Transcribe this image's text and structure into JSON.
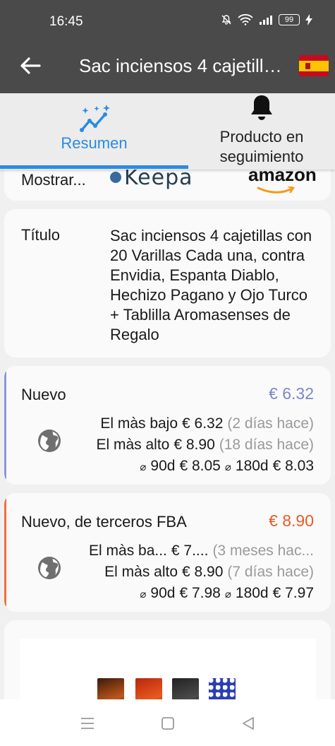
{
  "status_bar": {
    "time": "16:45",
    "battery": "99",
    "icons": [
      "mute-icon",
      "wifi-icon",
      "signal-icon",
      "battery-icon",
      "charging-icon"
    ]
  },
  "app_bar": {
    "title": "Sac inciensos 4 cajetillas con 20 Varillas Cada una, contra Envidia, Espanta Diablo, Hechizo Pagano y Ojo Turco + Tablilla Aromasenses de Regalo",
    "flag": "spain-flag"
  },
  "tabs": [
    {
      "label": "Resumen",
      "icon": "trend-sparkle-icon",
      "active": true
    },
    {
      "label": "Producto en seguimiento",
      "icon": "bell-icon",
      "active": false
    }
  ],
  "show_row": {
    "label": "Mostrar...",
    "keepa_logo": "Keepa",
    "amazon_logo": "amazon"
  },
  "title_card": {
    "key": "Título",
    "value": "Sac inciensos 4 cajetillas con 20 Varillas Cada una, contra Envidia, Espanta Diablo, Hechizo Pagano y Ojo Turco + Tablilla Aromasenses de Regalo"
  },
  "price_cards": [
    {
      "title": "Nuevo",
      "current": "€ 6.32",
      "accent": "#8d96d8",
      "lowest_label": "El màs bajo",
      "lowest_value": "€ 6.32",
      "lowest_when": "(2 días hace)",
      "highest_label": "El màs alto",
      "highest_value": "€ 8.90",
      "highest_when": "(18 días hace)",
      "avg_symbol": "⌀",
      "avg90_label": "90d",
      "avg90_value": "€ 8.05",
      "avg180_label": "180d",
      "avg180_value": "€ 8.03"
    },
    {
      "title": "Nuevo, de terceros FBA",
      "current": "€ 8.90",
      "accent": "#f16c3d",
      "lowest_label": "El màs ba...",
      "lowest_value": "€ 7....",
      "lowest_when": "(3 meses hac...",
      "highest_label": "El màs alto",
      "highest_value": "€ 8.90",
      "highest_when": "(7 días hace)",
      "avg_symbol": "⌀",
      "avg90_label": "90d",
      "avg90_value": "€ 7.98",
      "avg180_label": "180d",
      "avg180_value": "€ 7.97"
    }
  ],
  "nav_bar": {
    "buttons": [
      "menu-icon",
      "home-icon",
      "back-triangle-icon"
    ]
  }
}
